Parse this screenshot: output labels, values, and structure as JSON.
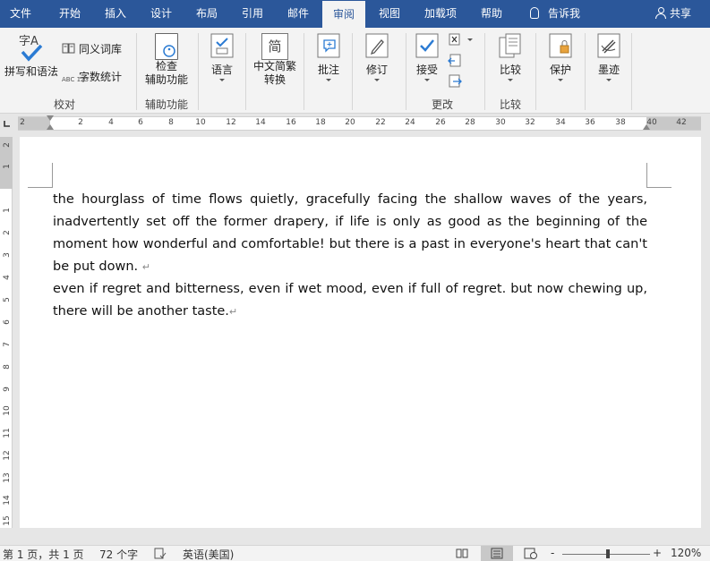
{
  "tabs": [
    "文件",
    "开始",
    "插入",
    "设计",
    "布局",
    "引用",
    "邮件",
    "审阅",
    "视图",
    "加载项",
    "帮助"
  ],
  "active_tab": "审阅",
  "tell_me": "告诉我",
  "share": "共享",
  "ribbon": {
    "proofing": {
      "spelling": "拼写和语法",
      "thesaurus": "同义词库",
      "word_count": "字数统计",
      "word_count_icon_text": "ABC 123",
      "spelling_icon_text": "字A",
      "label": "校对"
    },
    "accessibility": {
      "check_line1": "检查",
      "check_line2": "辅助功能",
      "label": "辅助功能"
    },
    "language": {
      "button": "语言"
    },
    "chinese": {
      "line1": "中文简繁",
      "line2": "转换",
      "icon_text": "简"
    },
    "comments": {
      "button": "批注"
    },
    "tracking": {
      "button": "修订"
    },
    "changes": {
      "accept": "接受",
      "label": "更改"
    },
    "compare": {
      "button": "比较",
      "label": "比较"
    },
    "protect": {
      "button": "保护"
    },
    "ink": {
      "button": "墨迹"
    }
  },
  "ruler": {
    "h_numbers": [
      "2",
      "2",
      "4",
      "6",
      "8",
      "10",
      "12",
      "14",
      "16",
      "18",
      "20",
      "22",
      "24",
      "26",
      "28",
      "30",
      "32",
      "34",
      "36",
      "38",
      "40",
      "42"
    ],
    "v_numbers": [
      "2",
      "1",
      "1",
      "2",
      "3",
      "4",
      "5",
      "6",
      "7",
      "8",
      "9",
      "10",
      "11",
      "12",
      "13",
      "14",
      "15"
    ]
  },
  "document": {
    "paragraph1": "the hourglass of time flows quietly, gracefully facing the shallow waves of the years, inadvertently set off the former drapery, if life is only as good as the beginning of the moment how wonderful and comfortable! but there is a past in everyone's heart that can't be put down.",
    "paragraph2": "even if regret and bitterness, even if wet mood, even if full of regret. but now chewing up, there will be another taste.",
    "para_mark": "↵"
  },
  "status": {
    "page": "第 1 页，共 1 页",
    "words": "72 个字",
    "language": "英语(美国)",
    "zoom": "120%",
    "zoom_minus": "-",
    "zoom_plus": "+"
  }
}
